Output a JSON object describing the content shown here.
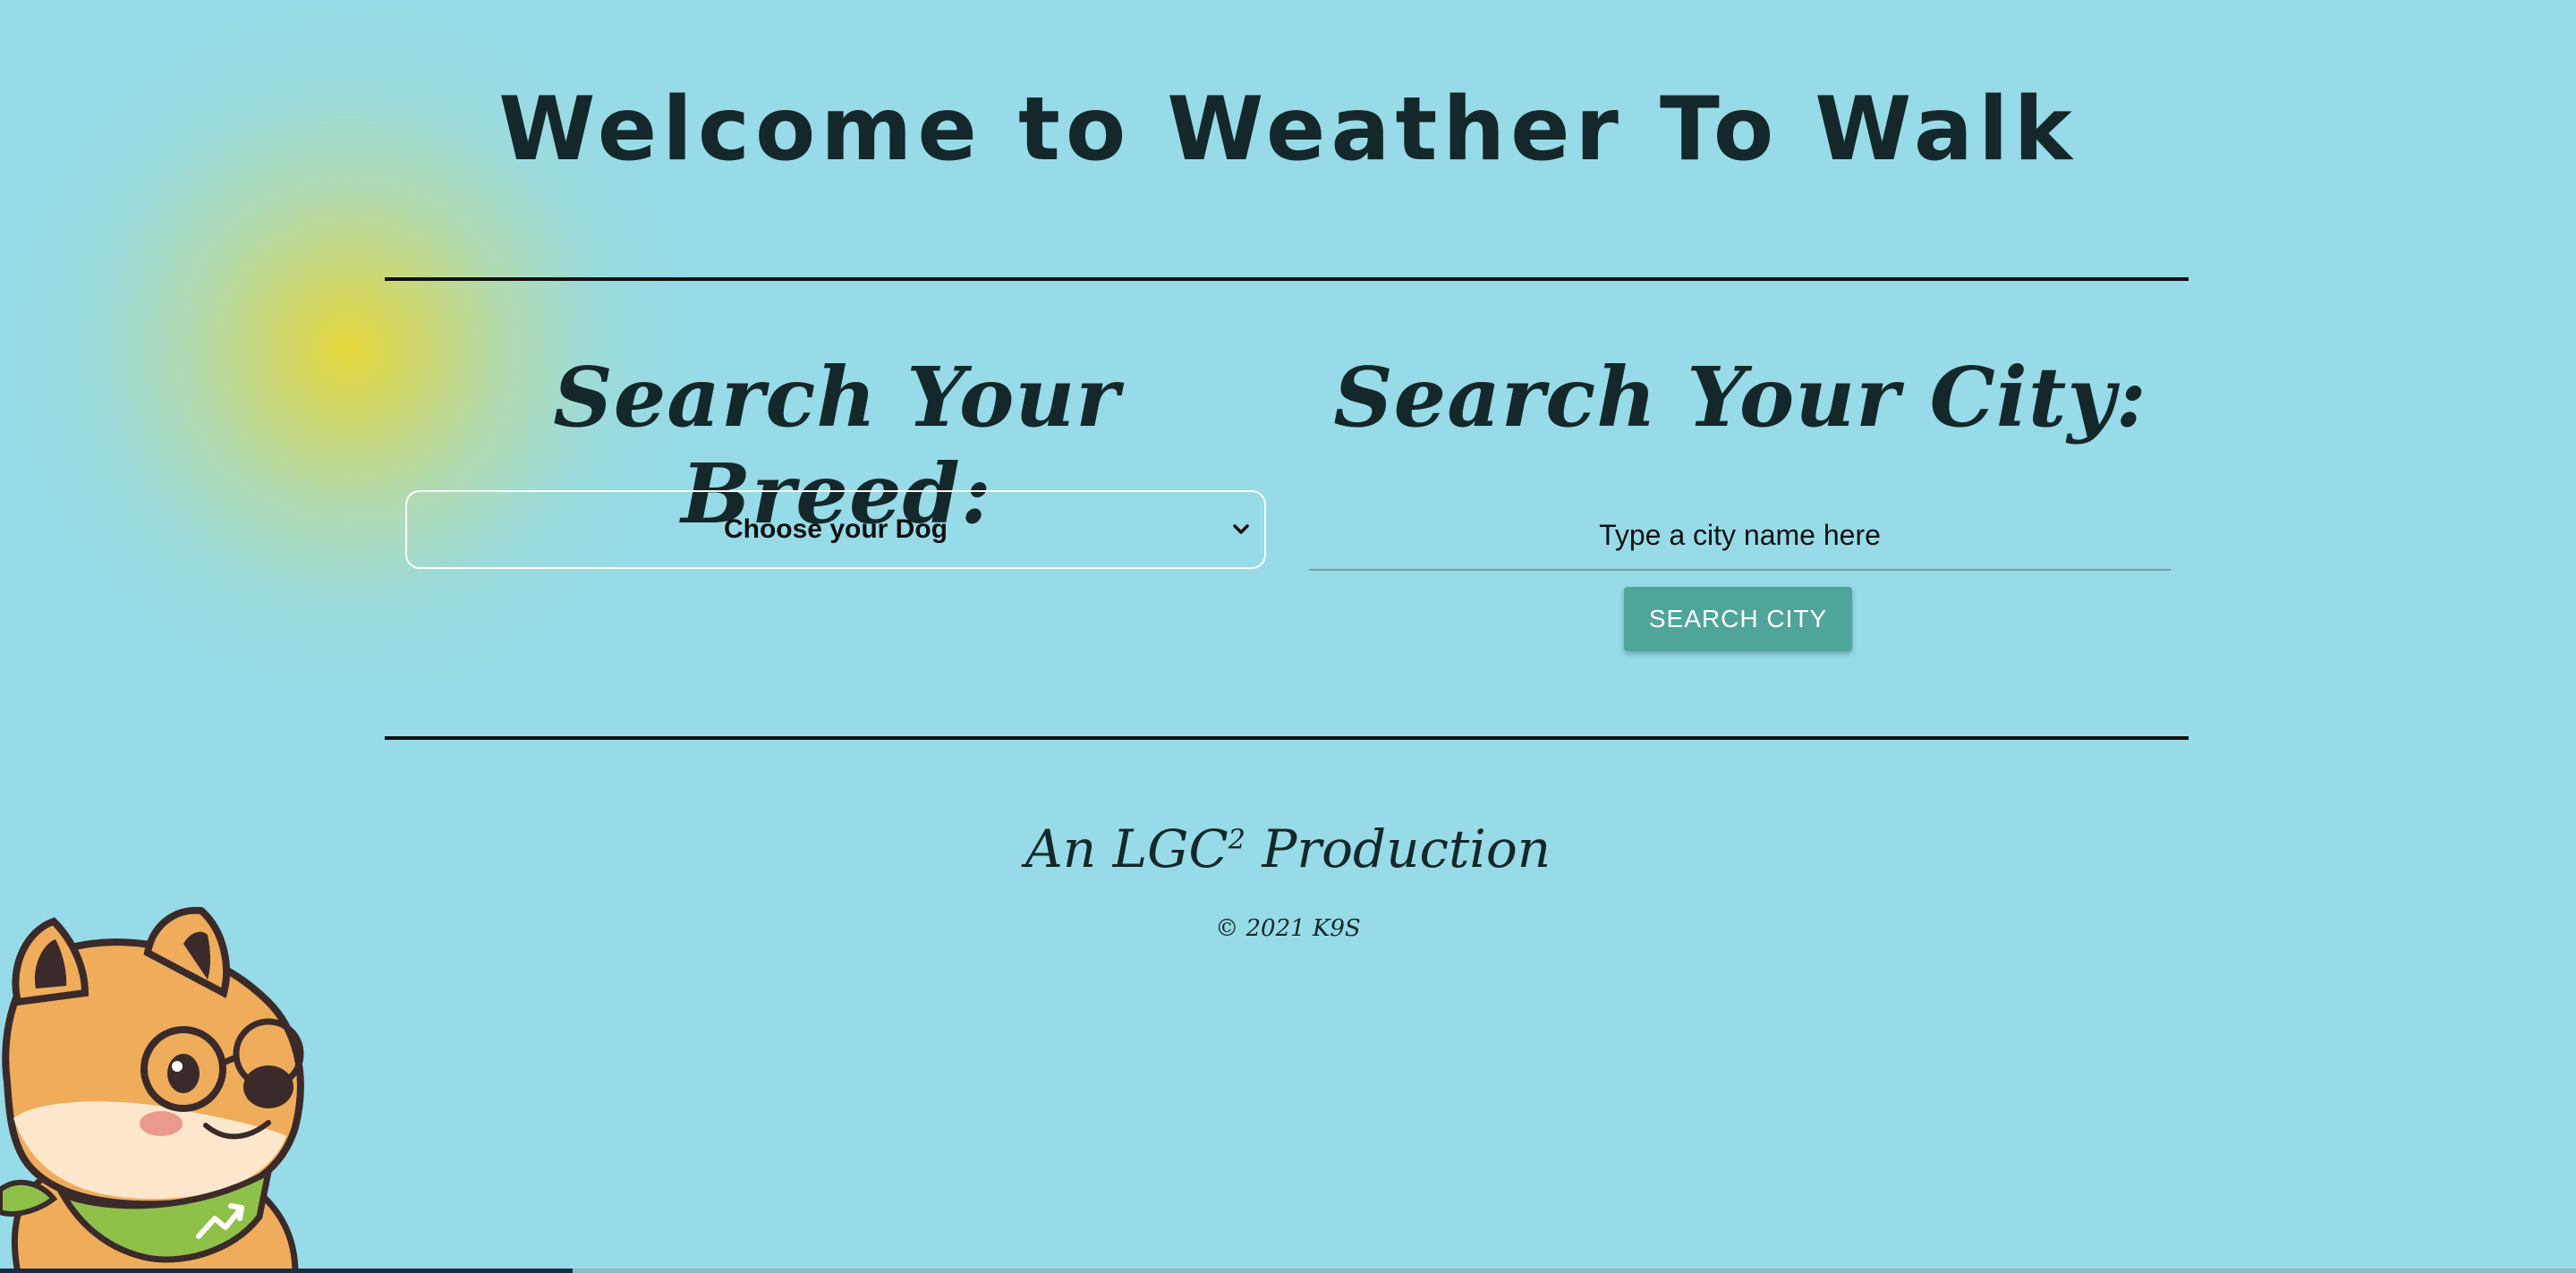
{
  "header": {
    "title": "Welcome to Weather To Walk"
  },
  "breed": {
    "heading": "Search Your Breed:",
    "select_value": "Choose your Dog"
  },
  "city": {
    "heading": "Search Your City:",
    "placeholder": "Type a city name here",
    "button_label": "SEARCH CITY"
  },
  "footer": {
    "production_prefix": "An LGC",
    "production_sup": "2",
    "production_suffix": " Production",
    "copyright": "© 2021 K9S"
  },
  "colors": {
    "background": "#96dbe7",
    "button": "#4fa59a",
    "sun": "#e6d83c"
  },
  "icons": {
    "select_arrow": "chevron-down-icon",
    "mascot": "shiba-dog-mascot"
  }
}
